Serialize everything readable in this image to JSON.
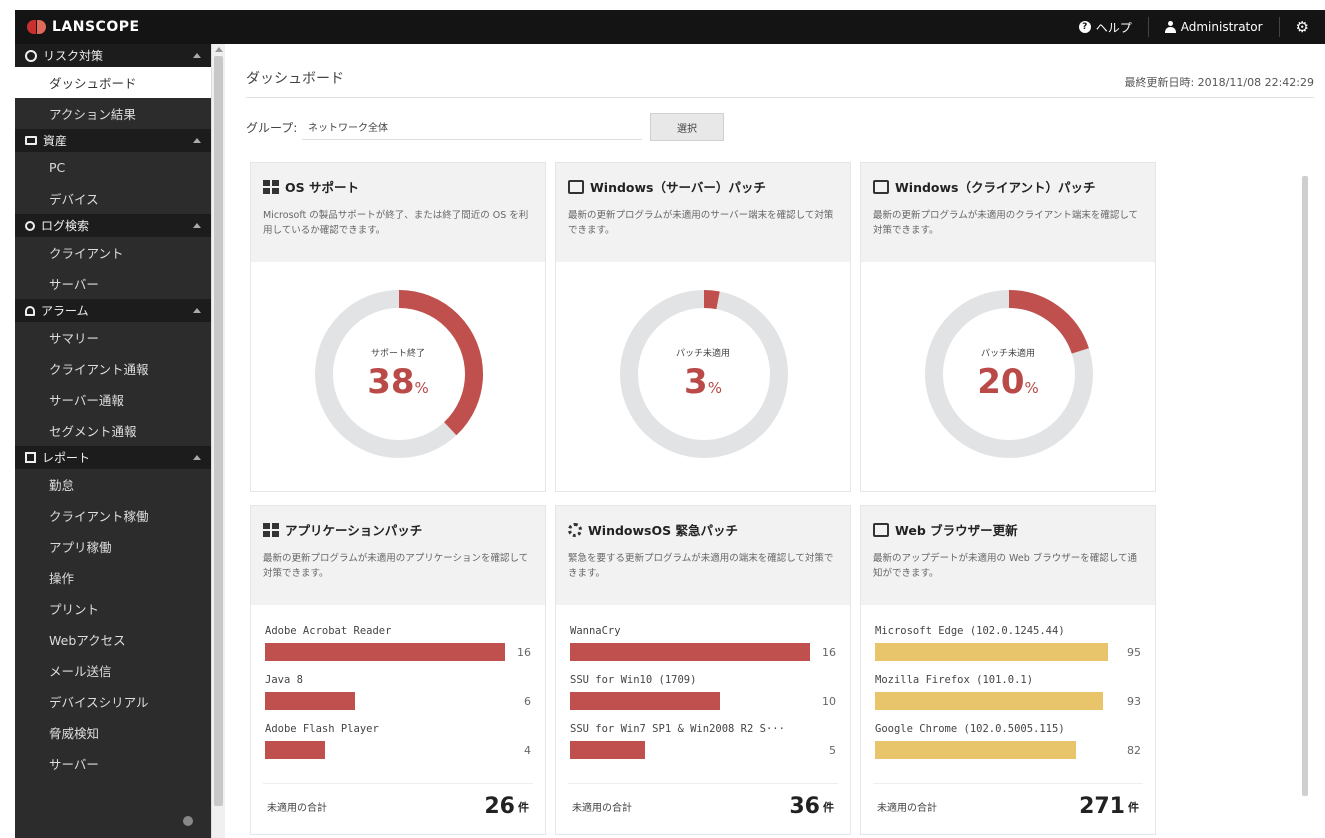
{
  "app": {
    "logo": "LANSCOPE"
  },
  "topbar": {
    "help": "ヘルプ",
    "user": "Administrator"
  },
  "sidebar": {
    "sections": [
      {
        "label": "リスク対策",
        "items": [
          "ダッシュボード",
          "アクション結果"
        ]
      },
      {
        "label": "資産",
        "items": [
          "PC",
          "デバイス"
        ]
      },
      {
        "label": "ログ検索",
        "items": [
          "クライアント",
          "サーバー"
        ]
      },
      {
        "label": "アラーム",
        "items": [
          "サマリー",
          "クライアント通報",
          "サーバー通報",
          "セグメント通報"
        ]
      },
      {
        "label": "レポート",
        "items": [
          "勤怠",
          "クライアント稼働",
          "アプリ稼働",
          "操作",
          "プリント",
          "Webアクセス",
          "メール送信",
          "デバイスシリアル",
          "脅威検知",
          "サーバー"
        ]
      }
    ]
  },
  "page": {
    "title": "ダッシュボード",
    "updated": "最終更新日時: 2018/11/08 22:42:29",
    "group_label": "グループ:",
    "group_value": "ネットワーク全体",
    "select_button": "選択"
  },
  "cards": {
    "os": {
      "title": "OS サポート",
      "desc": "Microsoft の製品サポートが終了、または終了間近の OS を利用しているか確認できます。",
      "donut_label": "サポート終了",
      "percent": 38,
      "pct_suffix": "%"
    },
    "server": {
      "title": "Windows（サーバー）パッチ",
      "desc": "最新の更新プログラムが未適用のサーバー端末を確認して対策できます。",
      "donut_label": "パッチ未適用",
      "percent": 3,
      "pct_suffix": "%"
    },
    "client": {
      "title": "Windows（クライアント）パッチ",
      "desc": "最新の更新プログラムが未適用のクライアント端末を確認して対策できます。",
      "donut_label": "パッチ未適用",
      "percent": 20,
      "pct_suffix": "%"
    },
    "app": {
      "title": "アプリケーションパッチ",
      "desc": "最新の更新プログラムが未適用のアプリケーションを確認して対策できます。",
      "max": 16,
      "bars": [
        {
          "name": "Adobe Acrobat Reader",
          "count": 16
        },
        {
          "name": "Java 8",
          "count": 6
        },
        {
          "name": "Adobe Flash Player",
          "count": 4
        }
      ],
      "total_label": "未適用の合計",
      "total": 26,
      "unit": "件"
    },
    "urgent": {
      "title": "WindowsOS 緊急パッチ",
      "desc": "緊急を要する更新プログラムが未適用の端末を確認して対策できます。",
      "max": 16,
      "bars": [
        {
          "name": "WannaCry",
          "count": 16
        },
        {
          "name": "SSU for Win10 (1709)",
          "count": 10
        },
        {
          "name": "SSU for Win7 SP1 & Win2008 R2 S···",
          "count": 5
        }
      ],
      "total_label": "未適用の合計",
      "total": 36,
      "unit": "件"
    },
    "browser": {
      "title": "Web ブラウザー更新",
      "desc": "最新のアップデートが未適用の Web ブラウザーを確認して通知ができます。",
      "max": 98,
      "bars": [
        {
          "name": "Microsoft Edge (102.0.1245.44)",
          "count": 95
        },
        {
          "name": "Mozilla Firefox (101.0.1)",
          "count": 93
        },
        {
          "name": "Google Chrome (102.0.5005.115)",
          "count": 82
        }
      ],
      "total_label": "未適用の合計",
      "total": 271,
      "unit": "件"
    }
  },
  "colors": {
    "red": "#c0504d",
    "yellow": "#e8c56a",
    "track": "#e2e3e5",
    "sidebar": "#2c2c2c",
    "topbar": "#141414"
  }
}
